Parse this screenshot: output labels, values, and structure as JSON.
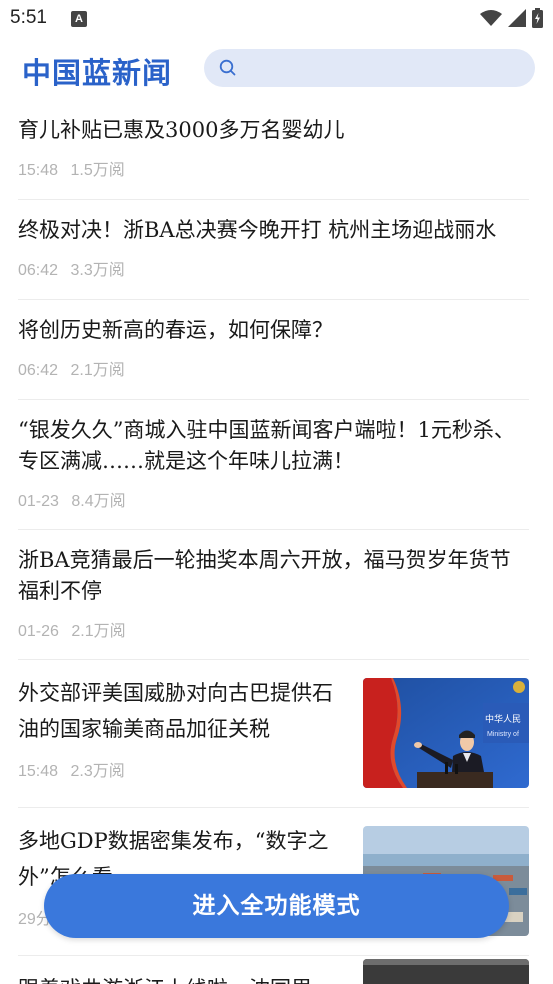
{
  "status_bar": {
    "time": "5:51",
    "notif_glyph": "A"
  },
  "header": {
    "brand": "中国蓝新闻",
    "search_placeholder": ""
  },
  "feed": [
    {
      "title": "育儿补贴已惠及3000多万名婴幼儿",
      "time": "15:48",
      "views": "1.5万阅"
    },
    {
      "title": "终极对决！浙BA总决赛今晚开打 杭州主场迎战丽水",
      "time": "06:42",
      "views": "3.3万阅"
    },
    {
      "title": "将创历史新高的春运，如何保障？",
      "time": "06:42",
      "views": "2.1万阅"
    },
    {
      "title": "“银发久久”商城入驻中国蓝新闻客户端啦！1元秒杀、专区满减……就是这个年味儿拉满！",
      "time": "01-23",
      "views": "8.4万阅"
    },
    {
      "title": "浙BA竞猜最后一轮抽奖本周六开放，福马贺岁年货节福利不停",
      "time": "01-26",
      "views": "2.1万阅"
    },
    {
      "title": "外交部评美国威胁对向古巴提供石油的国家输美商品加征关税",
      "time": "15:48",
      "views": "2.3万阅",
      "thumb": "press-conference-image",
      "thumb_sign": "中华人民",
      "thumb_sign2": "Ministry of"
    },
    {
      "title": "多地GDP数据密集发布，“数字之外”怎么看",
      "time": "29分",
      "views": "",
      "thumb": "container-port-image"
    },
    {
      "title": "跟着戏曲游浙江上线啦，沈园里",
      "time": "",
      "views": "",
      "thumb": "partial-image"
    }
  ],
  "cta": {
    "label": "进入全功能模式"
  },
  "colors": {
    "brand": "#2a62c9",
    "cta": "#3a78dc",
    "search_bg": "#e1e8f7"
  }
}
